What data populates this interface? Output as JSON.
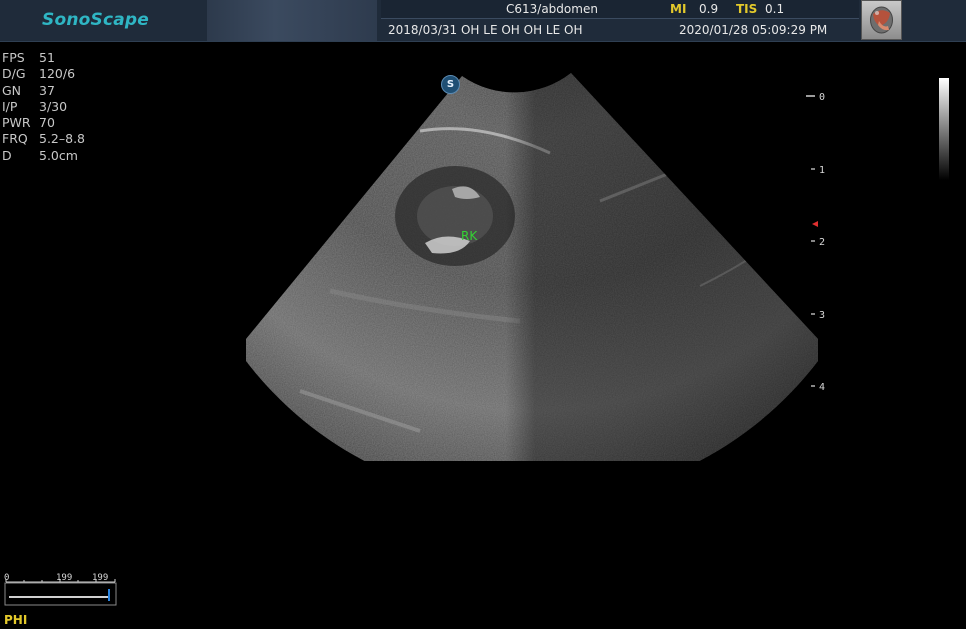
{
  "header": {
    "logo": "SonoScape",
    "probe_preset": "C613/abdomen",
    "mi_label": "MI",
    "mi_value": "0.9",
    "tis_label": "TIS",
    "tis_value": "0.1",
    "patient_line": "2018/03/31  OH LE OH OH LE OH",
    "datetime": "2020/01/28 05:09:29 PM",
    "exam_icon": "organ-kidney-icon"
  },
  "params": [
    {
      "key": "FPS",
      "value": "51"
    },
    {
      "key": "D/G",
      "value": "120/6"
    },
    {
      "key": "GN",
      "value": "37"
    },
    {
      "key": "I/P",
      "value": "3/30"
    },
    {
      "key": "PWR",
      "value": "70"
    },
    {
      "key": "FRQ",
      "value": "5.2–8.8"
    },
    {
      "key": "D",
      "value": "5.0cm"
    }
  ],
  "image": {
    "annotation": "RK",
    "orientation_marker": "S",
    "depth_ticks": [
      "0",
      "1",
      "2",
      "3",
      "4"
    ],
    "focus_depth_cm": 1.8,
    "colors": {
      "annotation": "#34d234",
      "marker": "#1f4f74"
    }
  },
  "phi": {
    "label": "PHI",
    "scale_left": "0",
    "scale_mid": "199",
    "scale_right": "199"
  }
}
